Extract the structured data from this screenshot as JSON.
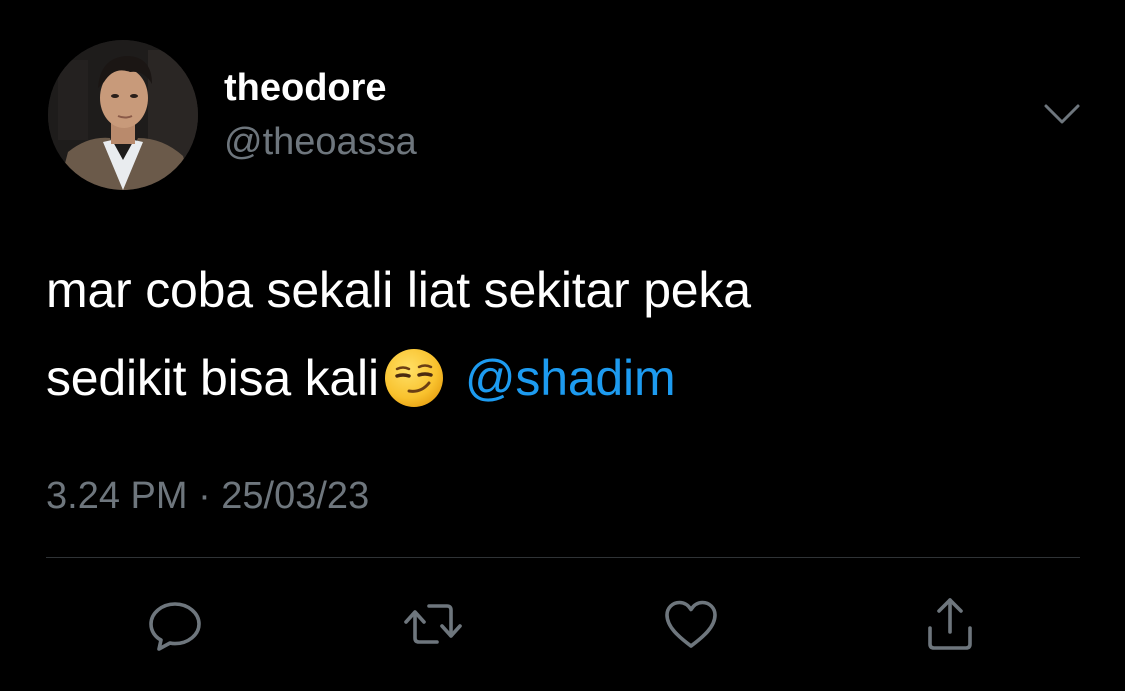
{
  "user": {
    "display_name": "theodore",
    "handle": "@theoassa"
  },
  "tweet": {
    "line1": "mar coba sekali liat sekitar peka",
    "line2": "sedikit bisa kali",
    "emoji": "smirking-face",
    "mention": "@shadim",
    "timestamp": "3.24 PM · 25/03/23"
  },
  "icons": {
    "menu": "chevron-down-icon",
    "reply": "reply-icon",
    "retweet": "retweet-icon",
    "like": "heart-icon",
    "share": "share-icon"
  },
  "colors": {
    "background": "#000000",
    "text": "#ffffff",
    "secondary": "#6e767d",
    "accent": "#1d9bf0",
    "divider": "#2f3336"
  }
}
